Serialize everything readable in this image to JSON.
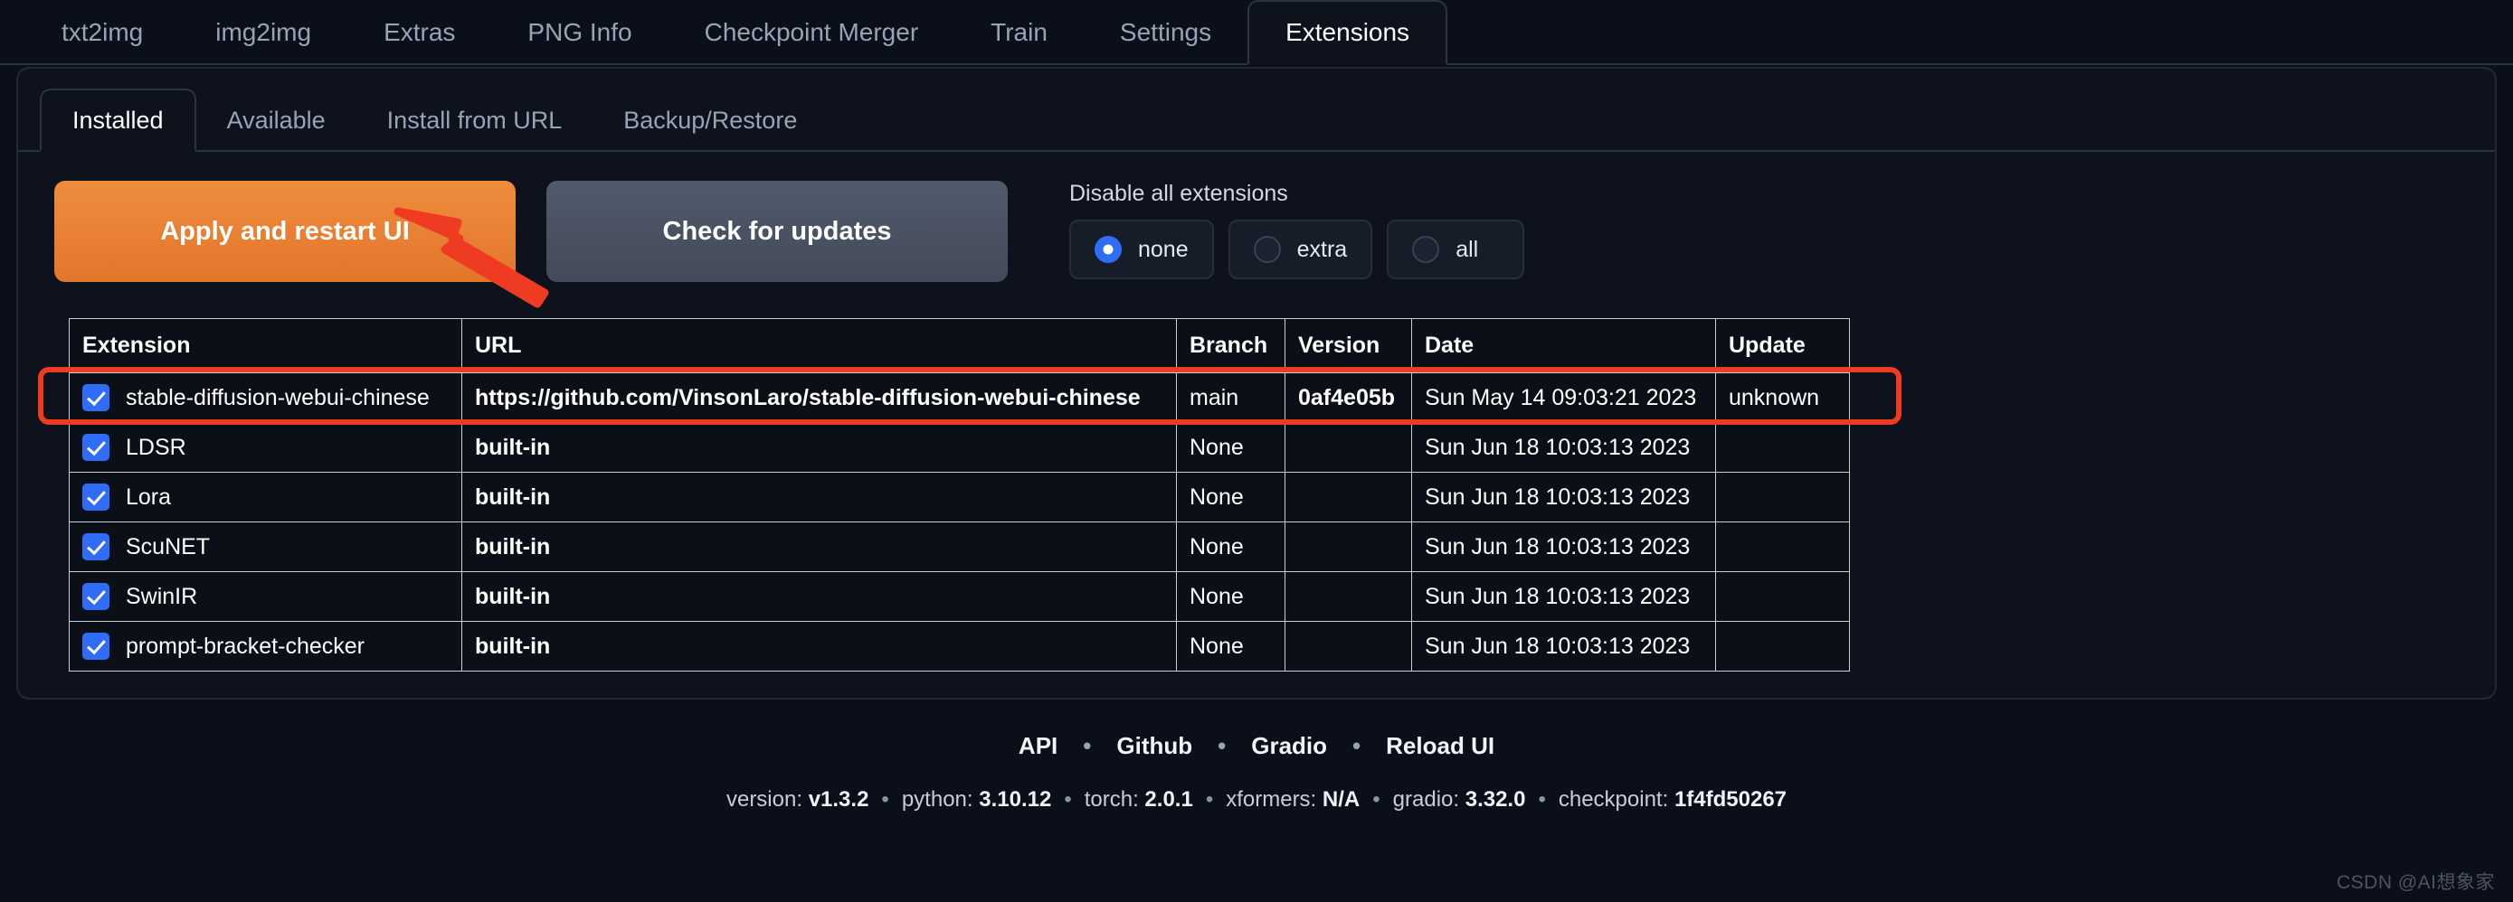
{
  "top_tabs": [
    {
      "label": "txt2img",
      "active": false
    },
    {
      "label": "img2img",
      "active": false
    },
    {
      "label": "Extras",
      "active": false
    },
    {
      "label": "PNG Info",
      "active": false
    },
    {
      "label": "Checkpoint Merger",
      "active": false
    },
    {
      "label": "Train",
      "active": false
    },
    {
      "label": "Settings",
      "active": false
    },
    {
      "label": "Extensions",
      "active": true
    }
  ],
  "sub_tabs": [
    {
      "label": "Installed",
      "active": true
    },
    {
      "label": "Available",
      "active": false
    },
    {
      "label": "Install from URL",
      "active": false
    },
    {
      "label": "Backup/Restore",
      "active": false
    }
  ],
  "controls": {
    "apply_button": "Apply and restart UI",
    "check_updates_button": "Check for updates",
    "disable_label": "Disable all extensions",
    "radios": [
      {
        "label": "none",
        "checked": true
      },
      {
        "label": "extra",
        "checked": false
      },
      {
        "label": "all",
        "checked": false
      }
    ]
  },
  "table": {
    "headers": [
      "Extension",
      "URL",
      "Branch",
      "Version",
      "Date",
      "Update"
    ],
    "rows": [
      {
        "checked": true,
        "extension": "stable-diffusion-webui-chinese",
        "url": "https://github.com/VinsonLaro/stable-diffusion-webui-chinese",
        "branch": "main",
        "version": "0af4e05b",
        "date": "Sun May 14 09:03:21 2023",
        "update": "unknown",
        "highlighted": true
      },
      {
        "checked": true,
        "extension": "LDSR",
        "url": "built-in",
        "branch": "None",
        "version": "",
        "date": "Sun Jun 18 10:03:13 2023",
        "update": "",
        "highlighted": false
      },
      {
        "checked": true,
        "extension": "Lora",
        "url": "built-in",
        "branch": "None",
        "version": "",
        "date": "Sun Jun 18 10:03:13 2023",
        "update": "",
        "highlighted": false
      },
      {
        "checked": true,
        "extension": "ScuNET",
        "url": "built-in",
        "branch": "None",
        "version": "",
        "date": "Sun Jun 18 10:03:13 2023",
        "update": "",
        "highlighted": false
      },
      {
        "checked": true,
        "extension": "SwinIR",
        "url": "built-in",
        "branch": "None",
        "version": "",
        "date": "Sun Jun 18 10:03:13 2023",
        "update": "",
        "highlighted": false
      },
      {
        "checked": true,
        "extension": "prompt-bracket-checker",
        "url": "built-in",
        "branch": "None",
        "version": "",
        "date": "Sun Jun 18 10:03:13 2023",
        "update": "",
        "highlighted": false
      }
    ]
  },
  "footer": {
    "links": [
      "API",
      "Github",
      "Gradio",
      "Reload UI"
    ],
    "separator": "•",
    "meta": [
      {
        "key": "version:",
        "value": "v1.3.2"
      },
      {
        "key": "python:",
        "value": "3.10.12"
      },
      {
        "key": "torch:",
        "value": "2.0.1"
      },
      {
        "key": "xformers:",
        "value": "N/A"
      },
      {
        "key": "gradio:",
        "value": "3.32.0"
      },
      {
        "key": "checkpoint:",
        "value": "1f4fd50267"
      }
    ]
  },
  "watermark": "CSDN @AI想象家",
  "colors": {
    "accent_orange": "#e2762a",
    "annotation_red": "#ee3b21",
    "radio_blue": "#2f6df6",
    "background": "#0b0f19"
  }
}
